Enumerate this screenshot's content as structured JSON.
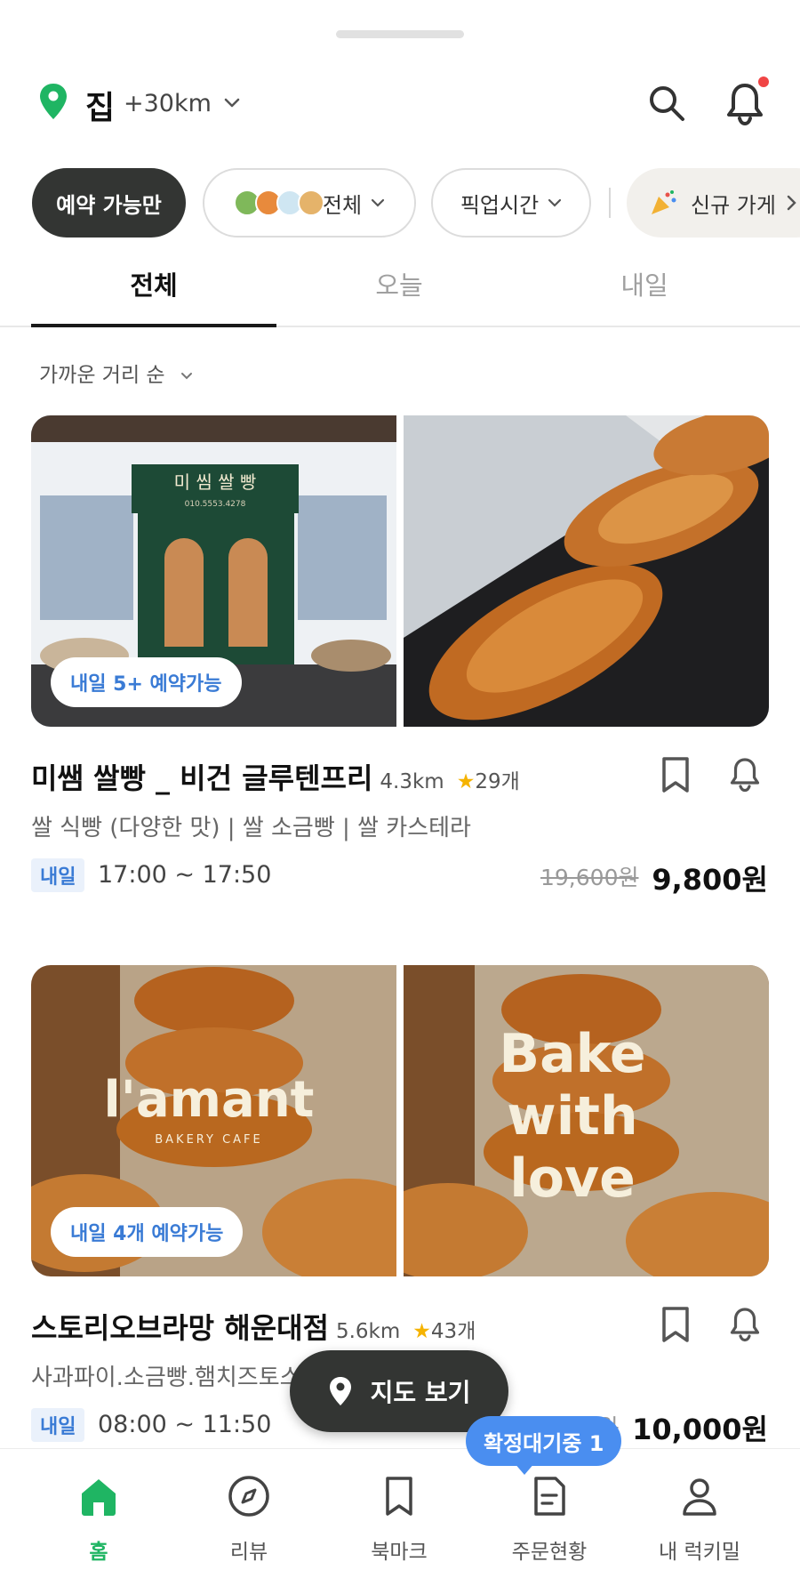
{
  "header": {
    "location_name": "집",
    "location_range": "+30km"
  },
  "filters": {
    "reservable_only": "예약 가능만",
    "category": "전체",
    "pickup_time": "픽업시간",
    "new_stores": "신규 가게"
  },
  "tabs": [
    {
      "label": "전체",
      "active": true
    },
    {
      "label": "오늘",
      "active": false
    },
    {
      "label": "내일",
      "active": false
    }
  ],
  "sort_label": "가까운 거리 순",
  "stores": [
    {
      "badge": "내일 5+ 예약가능",
      "name": "미쌤 쌀빵 _ 비건 글루텐프리",
      "distance": "4.3km",
      "rating": "29개",
      "menu": "쌀 식빵 (다양한 맛) | 쌀 소금빵 | 쌀 카스테라",
      "day": "내일",
      "pickup_time": "17:00 ~ 17:50",
      "original_price": "19,600원",
      "sale_price": "9,800원",
      "sign_text": "미 씸 쌀 빵",
      "sign_phone": "010.5553.4278"
    },
    {
      "badge": "내일 4개 예약가능",
      "name": "스토리오브라망 해운대점",
      "distance": "5.6km",
      "rating": "43개",
      "menu": "사과파이.소금빵.햄치즈토스트 | 블루베리 모카번",
      "day": "내일",
      "pickup_time": "08:00 ~ 11:50",
      "original_price": "20,000원",
      "sale_price": "10,000원",
      "logo_main": "l'amant",
      "logo_sub": "BAKERY CAFE",
      "slogan_lines": [
        "Bake",
        "with",
        "love"
      ]
    }
  ],
  "map_button": "지도 보기",
  "pending_bubble": "확정대기중 1",
  "bottom_nav": [
    {
      "label": "홈",
      "icon": "home-icon",
      "active": true
    },
    {
      "label": "리뷰",
      "icon": "compass-icon",
      "active": false
    },
    {
      "label": "북마크",
      "icon": "bookmark-icon",
      "active": false
    },
    {
      "label": "주문현황",
      "icon": "order-document-icon",
      "active": false
    },
    {
      "label": "내 럭키밀",
      "icon": "person-icon",
      "active": false
    }
  ],
  "colors": {
    "brand_green": "#1fb563",
    "accent_blue": "#3a7bd5",
    "dark_chip": "#333533",
    "notification_dot": "#f04545"
  }
}
